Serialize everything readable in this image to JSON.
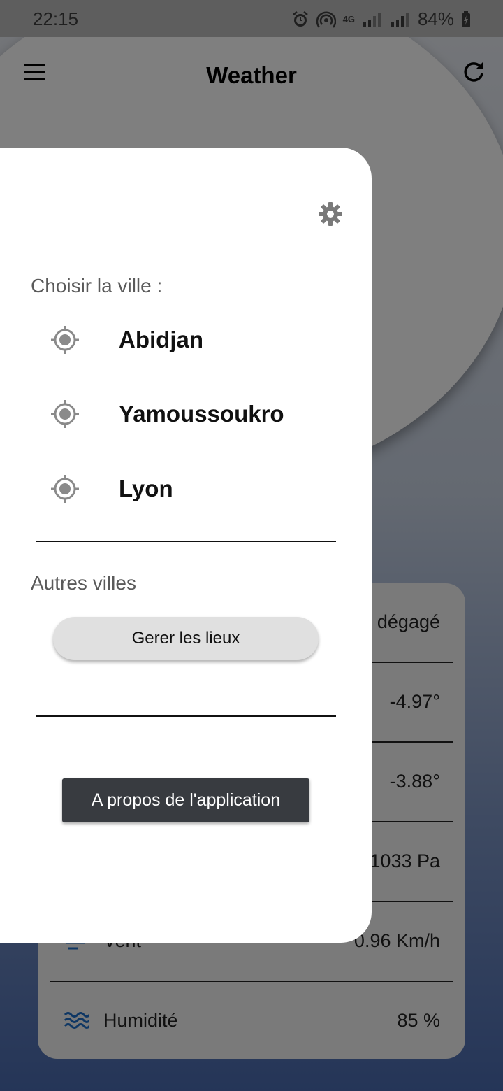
{
  "status_bar": {
    "time": "22:15",
    "battery": "84%",
    "network": "4G"
  },
  "app_bar": {
    "title": "Weather"
  },
  "drawer": {
    "choose_city_label": "Choisir la ville :",
    "cities": [
      "Abidjan",
      "Yamoussoukro",
      "Lyon"
    ],
    "other_cities_label": "Autres villes",
    "manage_button": "Gerer les lieux",
    "about_button": "A propos de l'application"
  },
  "weather_card": {
    "rows": [
      {
        "label": "",
        "value": "dégagé"
      },
      {
        "label": "",
        "value": "-4.97°"
      },
      {
        "label": "",
        "value": "-3.88°"
      },
      {
        "label": "",
        "value": "1033 Pa"
      },
      {
        "label": "Vent",
        "value": "0.96 Km/h"
      },
      {
        "label": "Humidité",
        "value": "85 %"
      }
    ]
  },
  "colors": {
    "accent": "#1e6fc8",
    "drawer_bg": "#ffffff",
    "about_button_bg": "#383b40"
  }
}
